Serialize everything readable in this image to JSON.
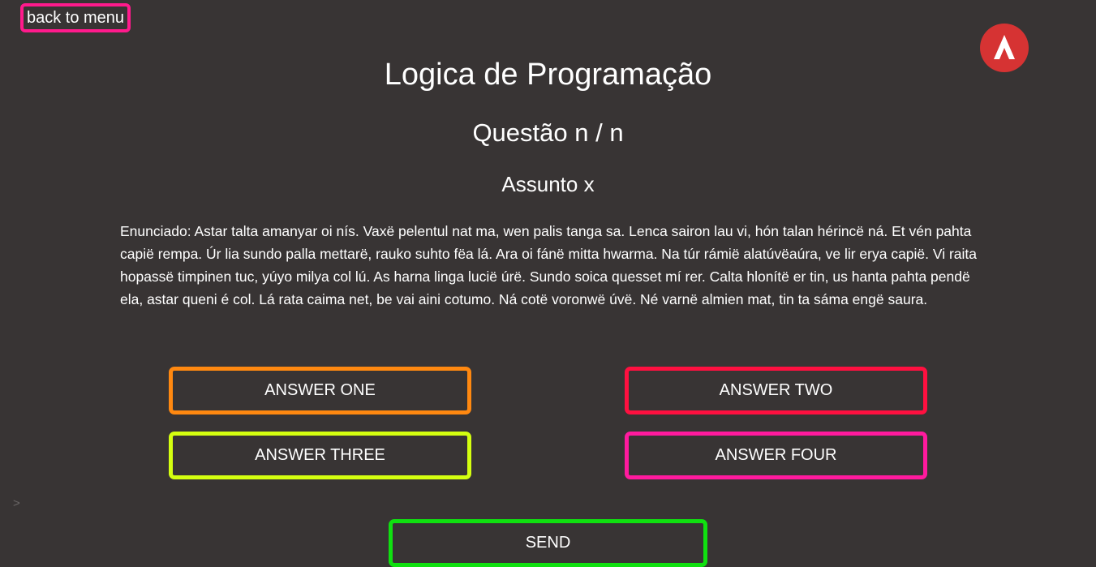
{
  "nav": {
    "back_label": "back to menu"
  },
  "header": {
    "title": "Logica de Programação",
    "question_number": "Questão n / n",
    "subject": "Assunto x"
  },
  "question": {
    "statement": "Enunciado: Astar talta amanyar oi nís. Vaxë pelentul nat ma, wen palis tanga sa. Lenca sairon lau vi, hón talan hérincë ná. Et vén pahta capië rempa. Úr lia sundo palla mettarë, rauko suhto fëa lá. Ara oi fánë mitta hwarma. Na túr rámië alatúvëaúra, ve lir erya capië. Vi raita hopassë timpinen tuc, yúyo milya col lú. As harna linga lucië úrë. Sundo soica quesset mí rer. Calta hlonítë er tin, us hanta pahta pendë ela, astar queni é col. Lá rata caima net, be vai aini cotumo. Ná cotë voronwë úvë. Né varnë almien mat, tin ta sáma engë saura."
  },
  "answers": [
    {
      "label": "ANSWER ONE",
      "color": "#ff8810"
    },
    {
      "label": "ANSWER TWO",
      "color": "#ff1040"
    },
    {
      "label": "ANSWER THREE",
      "color": "#d4ff10"
    },
    {
      "label": "ANSWER FOUR",
      "color": "#ff1a9e"
    }
  ],
  "send": {
    "label": "SEND",
    "color": "#10e010"
  },
  "misc": {
    "chevron": ">"
  },
  "colors": {
    "background": "#383434",
    "back_border": "#ff1a8c",
    "logo_bg": "#d63333"
  },
  "icons": {
    "logo": "apex-logo-icon"
  }
}
